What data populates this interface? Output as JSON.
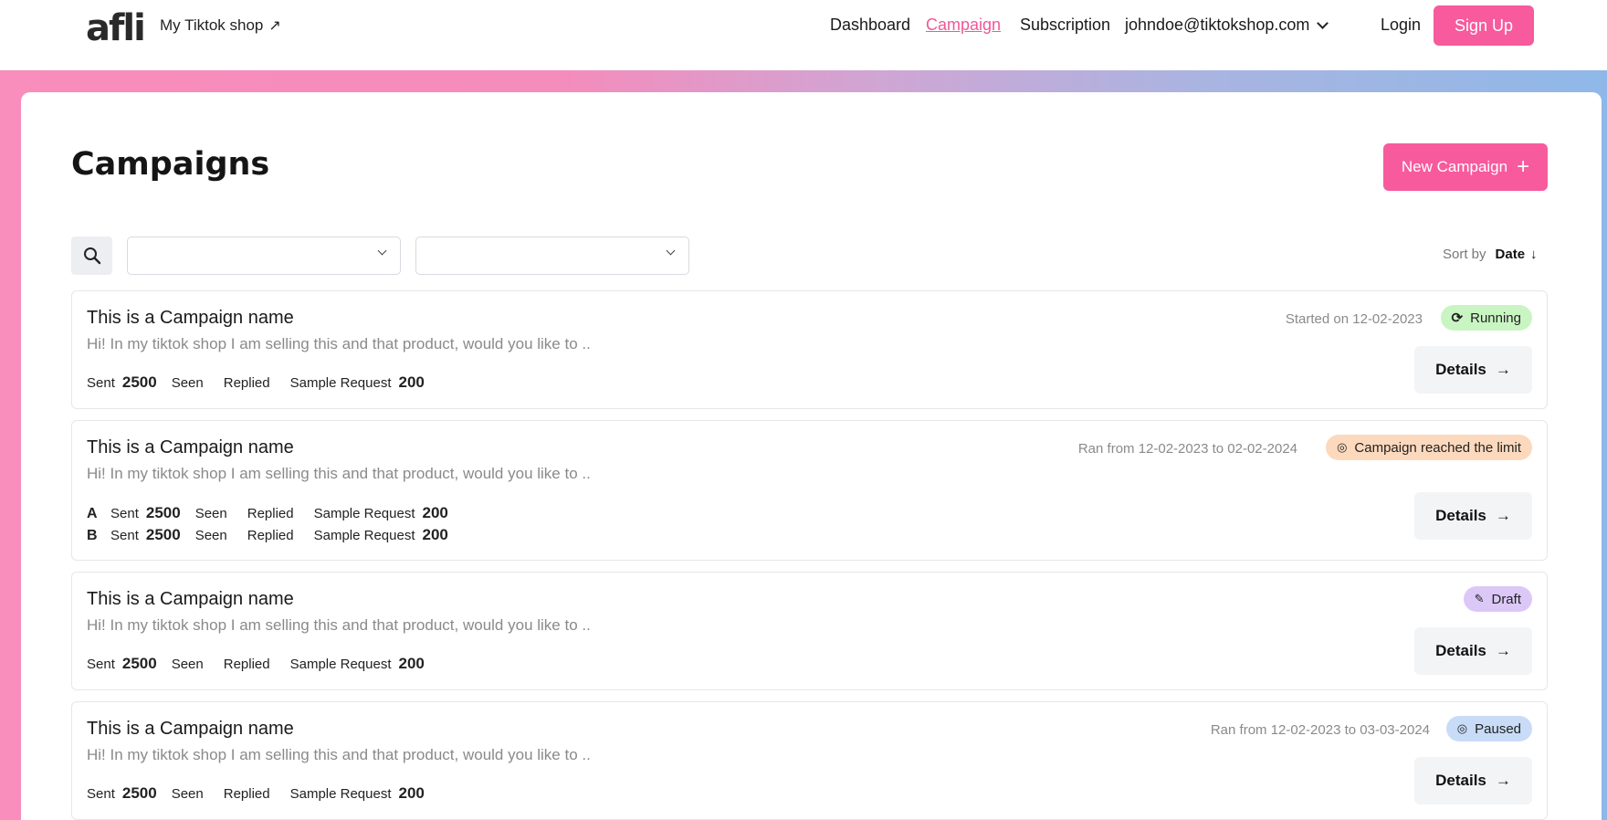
{
  "header": {
    "logo": "afli",
    "shop_link": "My Tiktok shop",
    "nav": [
      "Dashboard",
      "Campaign",
      "Subscription"
    ],
    "active_nav": "Campaign",
    "email": "johndoe@tiktokshop.com",
    "login": "Login",
    "signup": "Sign Up"
  },
  "page": {
    "title": "Campaigns",
    "new_campaign": "New Campaign",
    "filter_1_value": "",
    "filter_2_value": "",
    "sort_label": "Sort by",
    "sort_value": "Date"
  },
  "labels": {
    "sent": "Sent",
    "seen": "Seen",
    "replied": "Replied",
    "sample_request": "Sample Request",
    "details": "Details"
  },
  "campaigns": [
    {
      "name": "This is a Campaign name",
      "description": "Hi! In my tiktok shop I am selling this and that product, would you like to ..",
      "meta": "Started on 12-02-2023",
      "status": "Running",
      "status_color": "#c9f5c2",
      "status_icon": "refresh-icon",
      "sent": "2500",
      "sample_request": "200"
    },
    {
      "name": "This is a Campaign name",
      "description": "Hi! In my tiktok shop I am selling this and that product, would you like to ..",
      "meta": "Ran from 12-02-2023 to 02-02-2024",
      "status": "Campaign reached the limit",
      "status_color": "#fcd9bd",
      "status_icon": "stop-icon",
      "variants": [
        {
          "label": "A",
          "sent": "2500",
          "sample_request": "200"
        },
        {
          "label": "B",
          "sent": "2500",
          "sample_request": "200"
        }
      ]
    },
    {
      "name": "This is a Campaign name",
      "description": "Hi! In my tiktok shop I am selling this and that product, would you like to ..",
      "meta": "",
      "status": "Draft",
      "status_color": "#dcc8f7",
      "status_icon": "edit-icon",
      "sent": "2500",
      "sample_request": "200"
    },
    {
      "name": "This is a Campaign name",
      "description": "Hi! In my tiktok shop I am selling this and that product, would you like to ..",
      "meta": "Ran from 12-02-2023 to 03-03-2024",
      "status": "Paused",
      "status_color": "#c8dcf7",
      "status_icon": "pause-icon",
      "sent": "2500",
      "sample_request": "200"
    }
  ]
}
